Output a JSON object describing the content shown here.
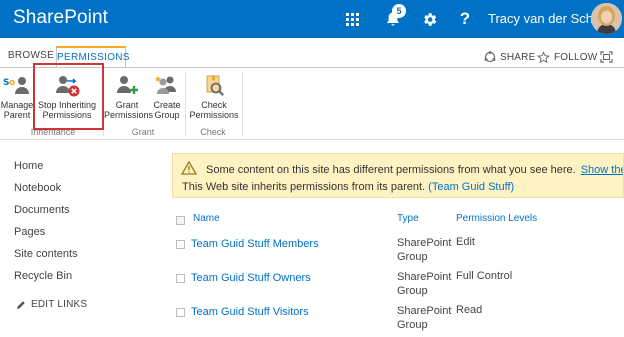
{
  "suite_bar": {
    "brand": "SharePoint",
    "notification_count": "5",
    "help_label": "?",
    "user_name": "Tracy van der Schyff"
  },
  "ribbon_tabs": {
    "browse": "BROWSE",
    "permissions": "PERMISSIONS"
  },
  "tab_actions": {
    "share": "SHARE",
    "follow": "FOLLOW"
  },
  "ribbon": {
    "manage_parent": [
      "Manage",
      "Parent"
    ],
    "stop_inheriting": [
      "Stop Inheriting",
      "Permissions"
    ],
    "grant_permissions": [
      "Grant",
      "Permissions"
    ],
    "create_group": [
      "Create",
      "Group"
    ],
    "check_permissions": [
      "Check",
      "Permissions"
    ],
    "groups": {
      "inheritance": "Inheritance",
      "grant": "Grant",
      "check": "Check"
    }
  },
  "left_nav": {
    "items": [
      "Home",
      "Notebook",
      "Documents",
      "Pages",
      "Site contents",
      "Recycle Bin"
    ],
    "edit_links": "EDIT LINKS"
  },
  "notice": {
    "message": "Some content on this site has different permissions from what you see here.",
    "link": "Show these items.",
    "inherit_text": "This Web site inherits permissions from its parent.",
    "parent_link": "(Team Guid Stuff)"
  },
  "table": {
    "headers": {
      "name": "Name",
      "type": "Type",
      "permission_levels": "Permission Levels"
    },
    "rows": [
      {
        "name": "Team Guid Stuff Members",
        "type": "SharePoint Group",
        "permission": "Edit"
      },
      {
        "name": "Team Guid Stuff Owners",
        "type": "SharePoint Group",
        "permission": "Full Control"
      },
      {
        "name": "Team Guid Stuff Visitors",
        "type": "SharePoint Group",
        "permission": "Read"
      }
    ]
  },
  "colors": {
    "suite_bar": "#0072c6",
    "tab_accent": "#f7a823",
    "highlight_box": "#d13438",
    "notice_bg": "#fff3c4",
    "link": "#0072c6"
  }
}
